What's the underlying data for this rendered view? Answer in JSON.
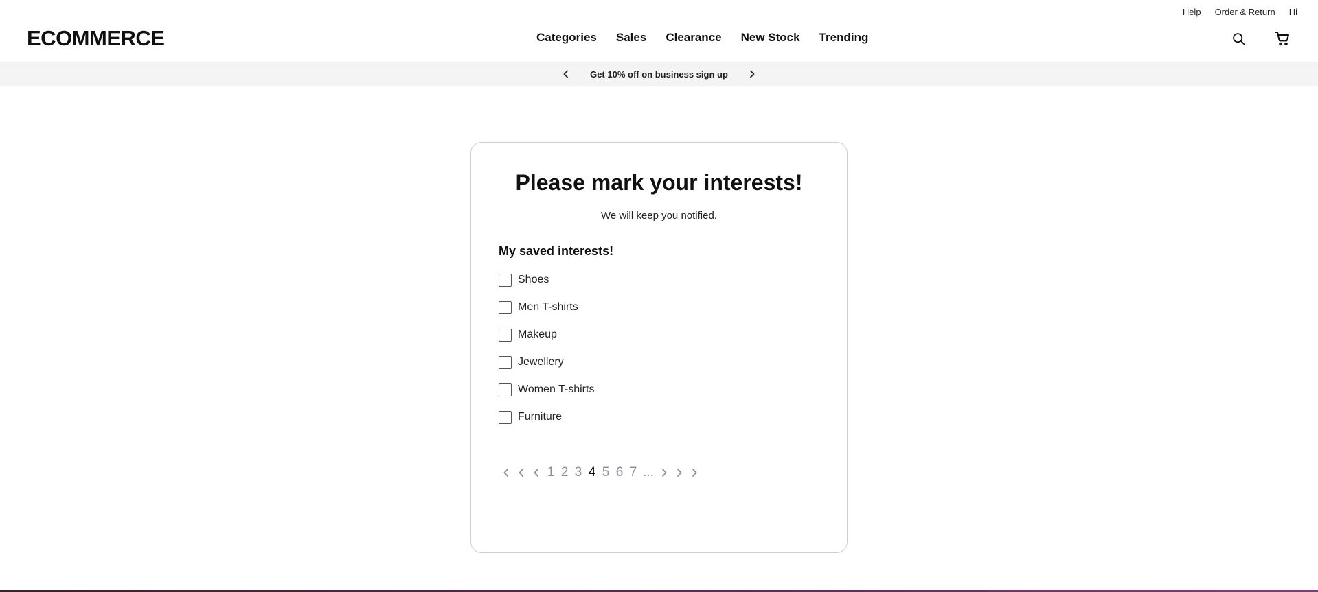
{
  "header": {
    "logo": "ECOMMERCE",
    "utility_links": [
      "Help",
      "Order & Return",
      "Hi"
    ],
    "nav": [
      "Categories",
      "Sales",
      "Clearance",
      "New Stock",
      "Trending"
    ],
    "icons": [
      "search-icon",
      "cart-icon"
    ]
  },
  "promo": {
    "text": "Get 10% off on business sign up",
    "icons": [
      "chevron-left-icon",
      "chevron-right-icon"
    ]
  },
  "card": {
    "title": "Please mark your interests!",
    "subtitle": "We will keep you notified.",
    "section_title": "My saved interests!",
    "interests": [
      {
        "label": "Shoes",
        "checked": false
      },
      {
        "label": "Men T-shirts",
        "checked": false
      },
      {
        "label": "Makeup",
        "checked": false
      },
      {
        "label": "Jewellery",
        "checked": false
      },
      {
        "label": "Women T-shirts",
        "checked": false
      },
      {
        "label": "Furniture",
        "checked": false
      }
    ],
    "pagination": {
      "pages": [
        "1",
        "2",
        "3",
        "4",
        "5",
        "6",
        "7"
      ],
      "current": "4",
      "ellipsis": "..."
    }
  },
  "colors": {
    "promo_bg": "#f4f4f4",
    "page_inactive": "#8a8f9c",
    "page_active": "#111111",
    "card_border": "#cfcfcf"
  }
}
